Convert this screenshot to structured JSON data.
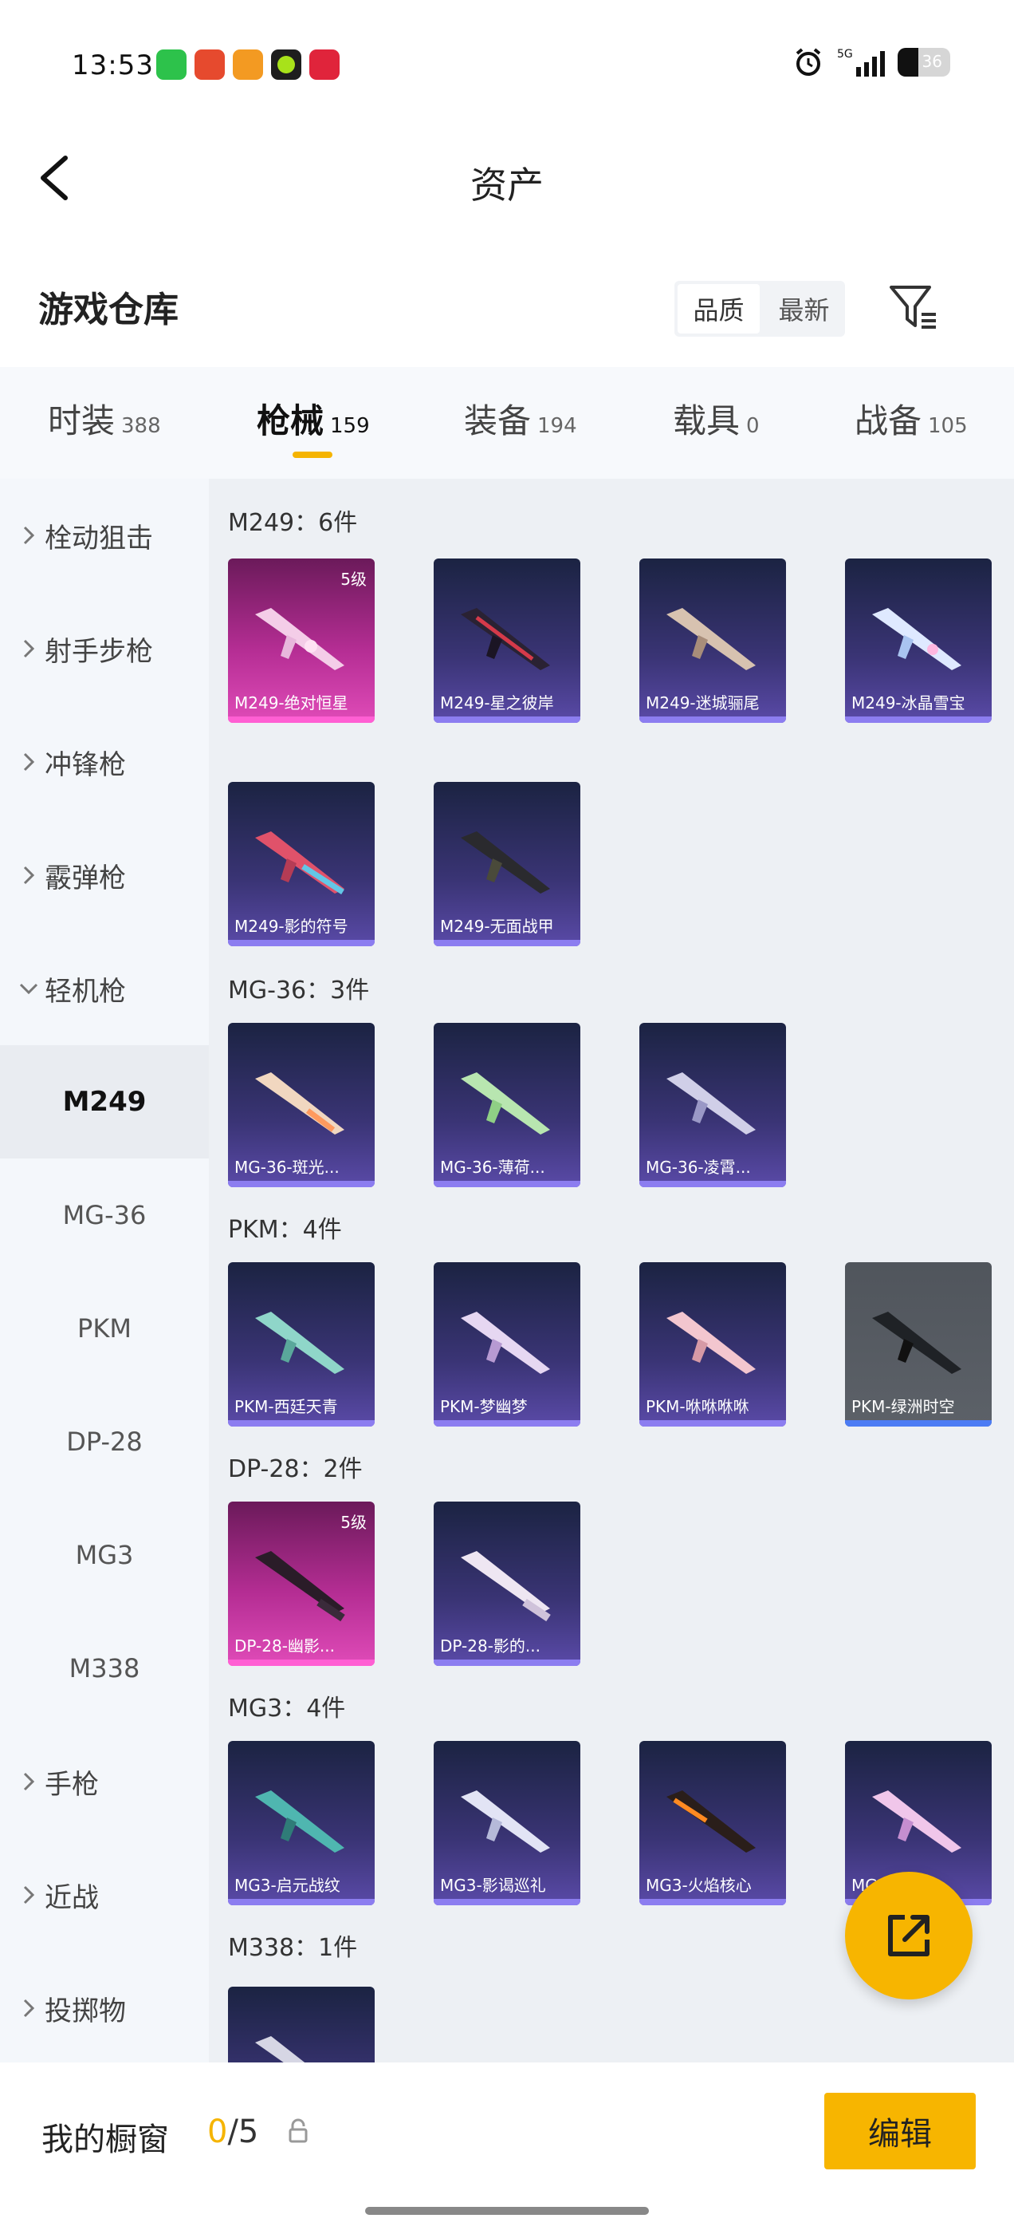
{
  "status": {
    "time": "13:53",
    "apps": [
      "wechat",
      "app-red",
      "app-orange",
      "app-green",
      "app-pinduoduo"
    ],
    "battery": "36",
    "network": "5G"
  },
  "header": {
    "title": "资产",
    "back_icon": "back-arrow-icon"
  },
  "section": {
    "title": "游戏仓库",
    "sort_options": [
      "品质",
      "最新"
    ],
    "filter_icon": "filter-icon"
  },
  "tabs": [
    {
      "label": "时装",
      "count": "388",
      "active": false
    },
    {
      "label": "枪械",
      "count": "159",
      "active": true
    },
    {
      "label": "装备",
      "count": "194",
      "active": false
    },
    {
      "label": "载具",
      "count": "0",
      "active": false
    },
    {
      "label": "战备",
      "count": "105",
      "active": false
    }
  ],
  "sidebar": {
    "categories": [
      {
        "label": "栓动狙击",
        "expanded": false
      },
      {
        "label": "射手步枪",
        "expanded": false
      },
      {
        "label": "冲锋枪",
        "expanded": false
      },
      {
        "label": "霰弹枪",
        "expanded": false
      },
      {
        "label": "轻机枪",
        "expanded": true
      }
    ],
    "subitems": [
      "M249",
      "MG-36",
      "PKM",
      "DP-28",
      "MG3",
      "M338"
    ],
    "selected_sub": "M249",
    "more": [
      "手枪",
      "近战",
      "投掷物"
    ]
  },
  "groups": [
    {
      "title": "M249：6件",
      "items": [
        {
          "name": "M249-绝对恒星",
          "level": "5级",
          "style": "pink"
        },
        {
          "name": "M249-星之彼岸",
          "style": "blue"
        },
        {
          "name": "M249-迷城骊尾",
          "style": "blue"
        },
        {
          "name": "M249-冰晶雪宝",
          "style": "blue"
        },
        {
          "name": "M249-影的符号",
          "style": "blue"
        },
        {
          "name": "M249-无面战甲",
          "style": "blue"
        }
      ]
    },
    {
      "title": "MG-36：3件",
      "items": [
        {
          "name": "MG-36-斑光...",
          "style": "blue"
        },
        {
          "name": "MG-36-薄荷...",
          "style": "blue"
        },
        {
          "name": "MG-36-凌霄...",
          "style": "blue"
        }
      ]
    },
    {
      "title": "PKM：4件",
      "items": [
        {
          "name": "PKM-西廷天青",
          "style": "blue"
        },
        {
          "name": "PKM-梦幽梦",
          "style": "blue"
        },
        {
          "name": "PKM-咻咻咻咻",
          "style": "blue"
        },
        {
          "name": "PKM-绿洲时空",
          "style": "gray"
        }
      ]
    },
    {
      "title": "DP-28：2件",
      "items": [
        {
          "name": "DP-28-幽影...",
          "level": "5级",
          "style": "pink"
        },
        {
          "name": "DP-28-影的...",
          "style": "blue"
        }
      ]
    },
    {
      "title": "MG3：4件",
      "items": [
        {
          "name": "MG3-启元战纹",
          "style": "blue"
        },
        {
          "name": "MG3-影谒巡礼",
          "style": "blue"
        },
        {
          "name": "MG3-火焰核心",
          "style": "blue"
        },
        {
          "name": "MG3-...冲",
          "style": "blue"
        }
      ]
    },
    {
      "title": "M338：1件",
      "items": [
        {
          "name": "",
          "style": "blue"
        }
      ]
    }
  ],
  "bottom": {
    "title": "我的橱窗",
    "used": "0",
    "total": "/5",
    "edit_label": "编辑",
    "share_icon": "share-icon"
  },
  "colors": {
    "accent": "#f7b500",
    "card_blue": "#3a3475",
    "card_pink": "#b42d93"
  }
}
